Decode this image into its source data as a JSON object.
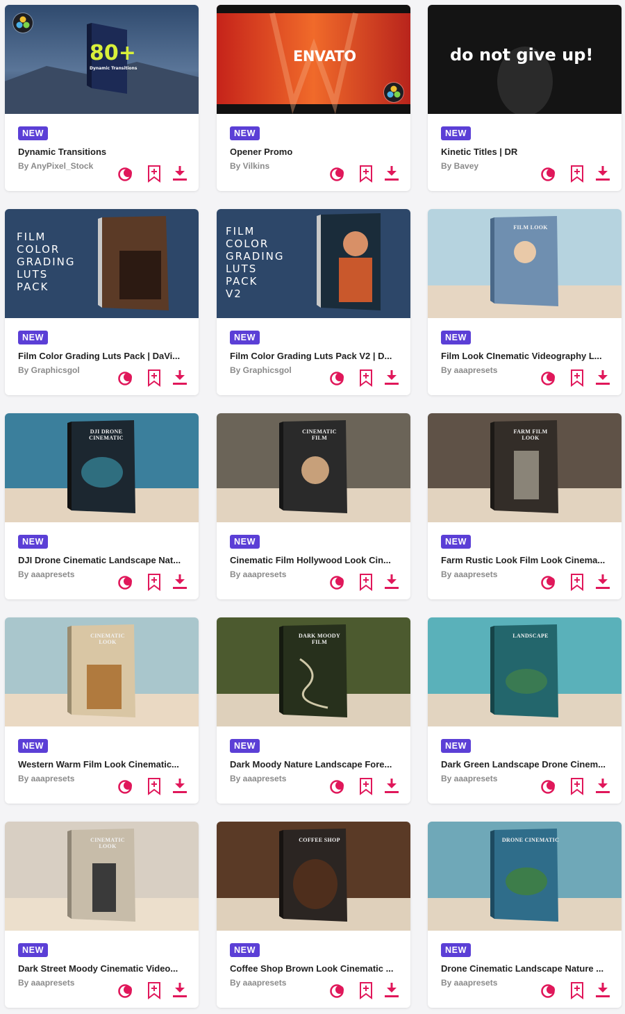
{
  "badge_label": "NEW",
  "colors": {
    "accent": "#e0175a",
    "badge": "#5b3fd6"
  },
  "icons": {
    "resolve": "davinci-resolve-icon",
    "bookmark": "bookmark-add-icon",
    "download": "download-icon"
  },
  "items": [
    {
      "title": "Dynamic Transitions",
      "author": "By AnyPixel_Stock",
      "thumb_text": "80+",
      "thumb_subtext": "Dynamic Transitions"
    },
    {
      "title": "Opener Promo",
      "author": "By Vilkins",
      "thumb_text": "ENVATO"
    },
    {
      "title": "Kinetic Titles | DR",
      "author": "By Bavey",
      "thumb_text": "do not give up!"
    },
    {
      "title": "Film Color Grading Luts Pack | DaVi...",
      "author": "By Graphicsgol",
      "thumb_text": "FILM\nCOLOR\nGRADING\nLUTS\nPACK"
    },
    {
      "title": "Film Color Grading Luts Pack V2 | D...",
      "author": "By Graphicsgol",
      "thumb_text": "FILM\nCOLOR\nGRADING\nLUTS\nPACK\nV2"
    },
    {
      "title": "Film Look CInematic Videography L...",
      "author": "By aaapresets",
      "box_text": "FILM LOOK"
    },
    {
      "title": "DJI Drone Cinematic Landscape Nat...",
      "author": "By aaapresets",
      "box_text": "DJI DRONE CINEMATIC"
    },
    {
      "title": "Cinematic Film Hollywood Look Cin...",
      "author": "By aaapresets",
      "box_text": "CINEMATIC FILM"
    },
    {
      "title": "Farm Rustic Look Film Look Cinema...",
      "author": "By aaapresets",
      "box_text": "FARM FILM LOOK"
    },
    {
      "title": "Western Warm Film Look Cinematic...",
      "author": "By aaapresets",
      "box_text": "CINEMATIC LOOK"
    },
    {
      "title": "Dark Moody Nature Landscape Fore...",
      "author": "By aaapresets",
      "box_text": "DARK MOODY FILM"
    },
    {
      "title": "Dark Green Landscape Drone Cinem...",
      "author": "By aaapresets",
      "box_text": "LANDSCAPE"
    },
    {
      "title": "Dark Street Moody Cinematic Video...",
      "author": "By aaapresets",
      "box_text": "CINEMATIC LOOK"
    },
    {
      "title": "Coffee Shop Brown Look Cinematic ...",
      "author": "By aaapresets",
      "box_text": "COFFEE SHOP"
    },
    {
      "title": "Drone Cinematic Landscape Nature ...",
      "author": "By aaapresets",
      "box_text": "DRONE CINEMATIC"
    }
  ]
}
